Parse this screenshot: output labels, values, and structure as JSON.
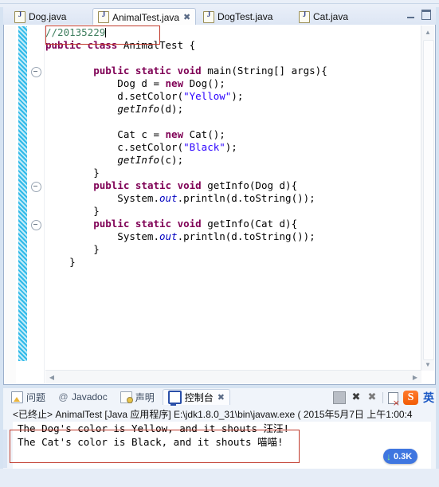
{
  "window": {
    "minimize_label": "minimize",
    "maximize_label": "maximize"
  },
  "editor_tabs": [
    {
      "label": "Dog.java",
      "active": false,
      "closable": false
    },
    {
      "label": "AnimalTest.java",
      "active": true,
      "closable": true
    },
    {
      "label": "DogTest.java",
      "active": false,
      "closable": false
    },
    {
      "label": "Cat.java",
      "active": false,
      "closable": false
    }
  ],
  "code": {
    "lines": [
      [
        {
          "t": "//20135229",
          "c": "cm"
        },
        {
          "t": "|CURSOR|",
          "c": "cursor"
        }
      ],
      [
        {
          "t": "public class ",
          "c": "kw"
        },
        {
          "t": "AnimalTest {",
          "c": ""
        }
      ],
      [
        {
          "t": "",
          "c": ""
        }
      ],
      [
        {
          "t": "        ",
          "c": ""
        },
        {
          "t": "public static void ",
          "c": "kw"
        },
        {
          "t": "main(String[] args){",
          "c": ""
        }
      ],
      [
        {
          "t": "            Dog d = ",
          "c": ""
        },
        {
          "t": "new ",
          "c": "kw"
        },
        {
          "t": "Dog();",
          "c": ""
        }
      ],
      [
        {
          "t": "            d.setColor(",
          "c": ""
        },
        {
          "t": "\"Yellow\"",
          "c": "st"
        },
        {
          "t": ");",
          "c": ""
        }
      ],
      [
        {
          "t": "            ",
          "c": ""
        },
        {
          "t": "getInfo",
          "c": "it"
        },
        {
          "t": "(d);",
          "c": ""
        }
      ],
      [
        {
          "t": "",
          "c": ""
        }
      ],
      [
        {
          "t": "            Cat c = ",
          "c": ""
        },
        {
          "t": "new ",
          "c": "kw"
        },
        {
          "t": "Cat();",
          "c": ""
        }
      ],
      [
        {
          "t": "            c.setColor(",
          "c": ""
        },
        {
          "t": "\"Black\"",
          "c": "st"
        },
        {
          "t": ");",
          "c": ""
        }
      ],
      [
        {
          "t": "            ",
          "c": ""
        },
        {
          "t": "getInfo",
          "c": "it"
        },
        {
          "t": "(c);",
          "c": ""
        }
      ],
      [
        {
          "t": "        }",
          "c": ""
        }
      ],
      [
        {
          "t": "        ",
          "c": ""
        },
        {
          "t": "public static void ",
          "c": "kw"
        },
        {
          "t": "getInfo(Dog d){",
          "c": ""
        }
      ],
      [
        {
          "t": "            System.",
          "c": ""
        },
        {
          "t": "out",
          "c": "fld"
        },
        {
          "t": ".println(d.toString());",
          "c": ""
        }
      ],
      [
        {
          "t": "        }",
          "c": ""
        }
      ],
      [
        {
          "t": "        ",
          "c": ""
        },
        {
          "t": "public static void ",
          "c": "kw"
        },
        {
          "t": "getInfo(Cat d){",
          "c": ""
        }
      ],
      [
        {
          "t": "            System.",
          "c": ""
        },
        {
          "t": "out",
          "c": "fld"
        },
        {
          "t": ".println(d.toString());",
          "c": ""
        }
      ],
      [
        {
          "t": "        }",
          "c": ""
        }
      ],
      [
        {
          "t": "    }",
          "c": ""
        }
      ]
    ],
    "fold_markers_at_lines": [
      3,
      12,
      15
    ]
  },
  "console": {
    "tabs": [
      {
        "label": "问题",
        "icon": "problems-icon",
        "active": false,
        "closable": false
      },
      {
        "label": "Javadoc",
        "icon": "javadoc-icon",
        "active": false,
        "closable": false
      },
      {
        "label": "声明",
        "icon": "declaration-icon",
        "active": false,
        "closable": false
      },
      {
        "label": "控制台",
        "icon": "console-icon",
        "active": true,
        "closable": true
      }
    ],
    "toolbar": [
      {
        "name": "terminate-icon",
        "label": "终止"
      },
      {
        "name": "remove-launch-icon",
        "label": "移除"
      },
      {
        "name": "remove-all-terminated-icon",
        "label": "移除全部"
      },
      {
        "name": "clear-console-icon",
        "label": "清除控制台"
      }
    ],
    "ime": {
      "logo_label": "S",
      "mode_label": "英"
    },
    "status_line": "<已终止> AnimalTest [Java 应用程序] E:\\jdk1.8.0_31\\bin\\javaw.exe ( 2015年5月7日 上午1:00:4",
    "output": [
      "The Dog's color is Yellow, and it shouts 汪汪!",
      "The Cat's color is Black, and it shouts 喵喵!"
    ]
  },
  "download_badge": {
    "arrow": "↓",
    "speed": "0.3K"
  },
  "colors": {
    "keyword": "#7f0055",
    "comment": "#3f7f5f",
    "string": "#2a00ff",
    "field": "#0000c0",
    "annotation_red": "#c0392b",
    "accent_blue": "#3f76e0",
    "chrome": "#d6e3f2"
  }
}
